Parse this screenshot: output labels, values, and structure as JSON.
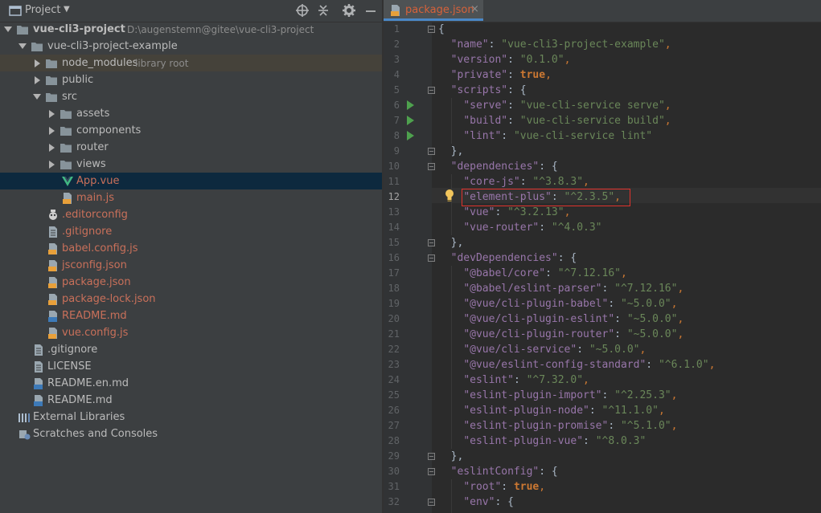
{
  "project_panel": {
    "title": "Project",
    "tree": [
      {
        "label": "vue-cli3-project",
        "path": "D:\\augenstemn@gitee\\vue-cli3-project"
      },
      {
        "label": "vue-cli3-project-example"
      },
      {
        "label": "node_modules",
        "sub": "library root"
      },
      {
        "label": "public"
      },
      {
        "label": "src"
      },
      {
        "label": "assets"
      },
      {
        "label": "components"
      },
      {
        "label": "router"
      },
      {
        "label": "views"
      },
      {
        "label": "App.vue"
      },
      {
        "label": "main.js"
      },
      {
        "label": ".editorconfig"
      },
      {
        "label": ".gitignore"
      },
      {
        "label": "babel.config.js"
      },
      {
        "label": "jsconfig.json"
      },
      {
        "label": "package.json"
      },
      {
        "label": "package-lock.json"
      },
      {
        "label": "README.md"
      },
      {
        "label": "vue.config.js"
      },
      {
        "label": ".gitignore"
      },
      {
        "label": "LICENSE"
      },
      {
        "label": "README.en.md"
      },
      {
        "label": "README.md"
      },
      {
        "label": "External Libraries"
      },
      {
        "label": "Scratches and Consoles"
      }
    ]
  },
  "editor": {
    "tab": {
      "label": "package.json",
      "close": "×"
    },
    "line_numbers": [
      "1",
      "2",
      "3",
      "4",
      "5",
      "6",
      "7",
      "8",
      "9",
      "10",
      "11",
      "12",
      "13",
      "14",
      "15",
      "16",
      "17",
      "18",
      "19",
      "20",
      "21",
      "22",
      "23",
      "24",
      "25",
      "26",
      "27",
      "28",
      "29",
      "30",
      "31",
      "32"
    ],
    "code": {
      "l1": {
        "t0": "{"
      },
      "l2": {
        "t0": "  ",
        "t1": "\"name\"",
        "t2": ": ",
        "t3": "\"vue-cli3-project-example\"",
        "t4": ","
      },
      "l3": {
        "t0": "  ",
        "t1": "\"version\"",
        "t2": ": ",
        "t3": "\"0.1.0\"",
        "t4": ","
      },
      "l4": {
        "t0": "  ",
        "t1": "\"private\"",
        "t2": ": ",
        "t3": "true",
        "t4": ","
      },
      "l5": {
        "t0": "  ",
        "t1": "\"scripts\"",
        "t2": ": {"
      },
      "l6": {
        "t0": "    ",
        "t1": "\"serve\"",
        "t2": ": ",
        "t3": "\"vue-cli-service serve\"",
        "t4": ","
      },
      "l7": {
        "t0": "    ",
        "t1": "\"build\"",
        "t2": ": ",
        "t3": "\"vue-cli-service build\"",
        "t4": ","
      },
      "l8": {
        "t0": "    ",
        "t1": "\"lint\"",
        "t2": ": ",
        "t3": "\"vue-cli-service lint\""
      },
      "l9": {
        "t0": "  },"
      },
      "l10": {
        "t0": "  ",
        "t1": "\"dependencies\"",
        "t2": ": {"
      },
      "l11": {
        "t0": "    ",
        "t1": "\"core-js\"",
        "t2": ": ",
        "t3": "\"^3.8.3\"",
        "t4": ","
      },
      "l12": {
        "t0": "    ",
        "t1": "\"element-plus\"",
        "t2": ": ",
        "t3": "\"^2.3.5\"",
        "t4": ","
      },
      "l13": {
        "t0": "    ",
        "t1": "\"vue\"",
        "t2": ": ",
        "t3": "\"^3.2.13\"",
        "t4": ","
      },
      "l14": {
        "t0": "    ",
        "t1": "\"vue-router\"",
        "t2": ": ",
        "t3": "\"^4.0.3\""
      },
      "l15": {
        "t0": "  },"
      },
      "l16": {
        "t0": "  ",
        "t1": "\"devDependencies\"",
        "t2": ": {"
      },
      "l17": {
        "t0": "    ",
        "t1": "\"@babel/core\"",
        "t2": ": ",
        "t3": "\"^7.12.16\"",
        "t4": ","
      },
      "l18": {
        "t0": "    ",
        "t1": "\"@babel/eslint-parser\"",
        "t2": ": ",
        "t3": "\"^7.12.16\"",
        "t4": ","
      },
      "l19": {
        "t0": "    ",
        "t1": "\"@vue/cli-plugin-babel\"",
        "t2": ": ",
        "t3": "\"~5.0.0\"",
        "t4": ","
      },
      "l20": {
        "t0": "    ",
        "t1": "\"@vue/cli-plugin-eslint\"",
        "t2": ": ",
        "t3": "\"~5.0.0\"",
        "t4": ","
      },
      "l21": {
        "t0": "    ",
        "t1": "\"@vue/cli-plugin-router\"",
        "t2": ": ",
        "t3": "\"~5.0.0\"",
        "t4": ","
      },
      "l22": {
        "t0": "    ",
        "t1": "\"@vue/cli-service\"",
        "t2": ": ",
        "t3": "\"~5.0.0\"",
        "t4": ","
      },
      "l23": {
        "t0": "    ",
        "t1": "\"@vue/eslint-config-standard\"",
        "t2": ": ",
        "t3": "\"^6.1.0\"",
        "t4": ","
      },
      "l24": {
        "t0": "    ",
        "t1": "\"eslint\"",
        "t2": ": ",
        "t3": "\"^7.32.0\"",
        "t4": ","
      },
      "l25": {
        "t0": "    ",
        "t1": "\"eslint-plugin-import\"",
        "t2": ": ",
        "t3": "\"^2.25.3\"",
        "t4": ","
      },
      "l26": {
        "t0": "    ",
        "t1": "\"eslint-plugin-node\"",
        "t2": ": ",
        "t3": "\"^11.1.0\"",
        "t4": ","
      },
      "l27": {
        "t0": "    ",
        "t1": "\"eslint-plugin-promise\"",
        "t2": ": ",
        "t3": "\"^5.1.0\"",
        "t4": ","
      },
      "l28": {
        "t0": "    ",
        "t1": "\"eslint-plugin-vue\"",
        "t2": ": ",
        "t3": "\"^8.0.3\""
      },
      "l29": {
        "t0": "  },"
      },
      "l30": {
        "t0": "  ",
        "t1": "\"eslintConfig\"",
        "t2": ": {"
      },
      "l31": {
        "t0": "    ",
        "t1": "\"root\"",
        "t2": ": ",
        "t3": "true",
        "t4": ","
      },
      "l32": {
        "t0": "    ",
        "t1": "\"env\"",
        "t2": ": {"
      }
    }
  },
  "colors": {
    "background": "#2b2b2b",
    "panel": "#3c3f41",
    "selection": "#0d293e",
    "json_key": "#9876aa",
    "json_string": "#6a8759",
    "keyword": "#cc7832",
    "modified_file": "#c9705a",
    "highlight_box": "#e0322c"
  },
  "icons": [
    "project-window-icon",
    "locate-icon",
    "collapse-all-icon",
    "settings-icon",
    "hide-icon",
    "folder-icon",
    "vue-file-icon",
    "js-file-icon",
    "json-file-icon",
    "markdown-file-icon",
    "text-file-icon",
    "library-icon",
    "scratches-icon",
    "run-icon",
    "lightbulb-icon",
    "fold-icon"
  ]
}
